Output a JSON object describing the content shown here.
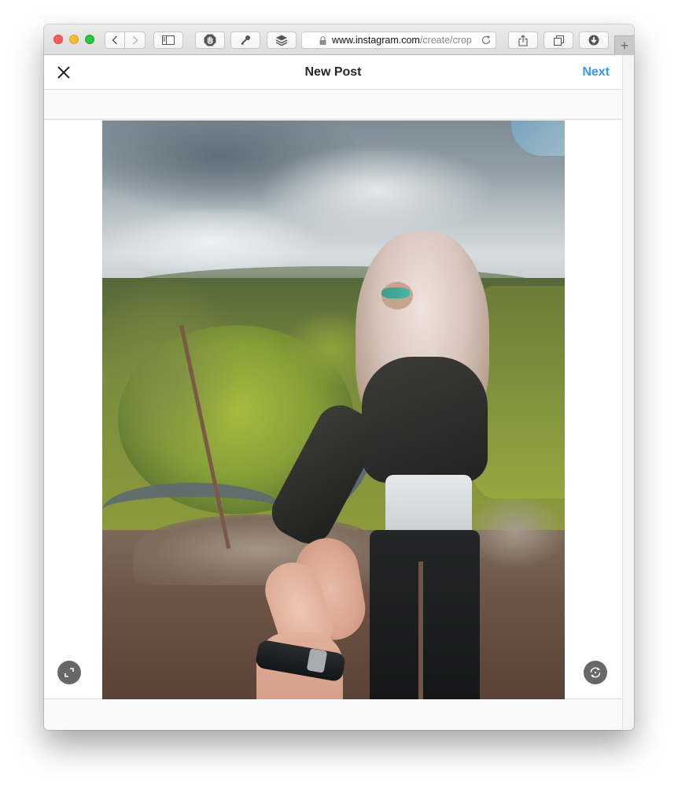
{
  "browser": {
    "window_controls": [
      "close",
      "minimize",
      "zoom"
    ],
    "nav": {
      "back_icon": "chevron-left-icon",
      "forward_icon": "chevron-right-icon"
    },
    "toolbar_buttons": [
      {
        "name": "sidebar",
        "icon": "sidebar-icon"
      },
      {
        "name": "content-blocker",
        "icon": "hand-stop-icon"
      },
      {
        "name": "passwords",
        "icon": "key-icon"
      },
      {
        "name": "layers",
        "icon": "layers-icon"
      }
    ],
    "address_bar": {
      "url_host": "www.instagram.com",
      "url_path": "/create/crop",
      "secure": true
    },
    "right_buttons": [
      {
        "name": "share",
        "icon": "share-icon"
      },
      {
        "name": "tabs-overview",
        "icon": "tabs-icon"
      },
      {
        "name": "downloads",
        "icon": "download-icon"
      }
    ],
    "new_tab_label": "+"
  },
  "page": {
    "header": {
      "close_icon": "close-icon",
      "title": "New Post",
      "next_label": "Next"
    },
    "photo": {
      "description": "Woman with blonde hair and sunglasses in black leather jacket leading a hand along a cliff overlooking a winding river valley"
    },
    "controls": {
      "expand_icon": "expand-icon",
      "rotate_icon": "rotate-icon"
    }
  },
  "colors": {
    "accent": "#3897f0",
    "title_text": "#262626",
    "control_bg": "#595959"
  }
}
